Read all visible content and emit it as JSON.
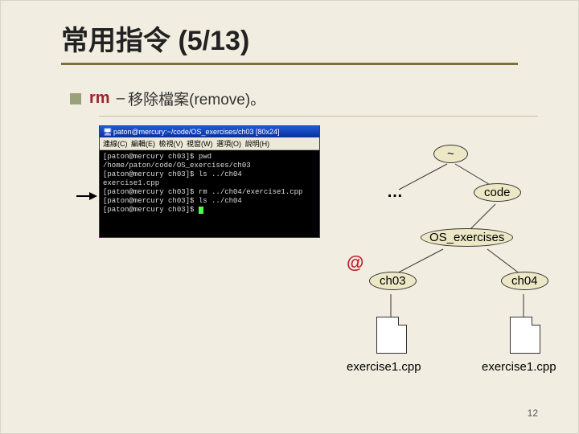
{
  "title": "常用指令 (5/13)",
  "bullet": {
    "cmd": "rm",
    "dash": "–",
    "desc": "移除檔案(remove)。"
  },
  "terminal": {
    "title": "paton@mercury:~/code/OS_exercises/ch03 [80x24]",
    "menu": [
      "連線(C)",
      "編輯(E)",
      "檢視(V)",
      "視窗(W)",
      "選項(O)",
      "說明(H)"
    ],
    "lines": [
      "[paton@mercury ch03]$ pwd",
      "/home/paton/code/OS_exercises/ch03",
      "[paton@mercury ch03]$ ls ../ch04",
      "exercise1.cpp",
      "[paton@mercury ch03]$ rm ../ch04/exercise1.cpp",
      "[paton@mercury ch03]$ ls ../ch04",
      "[paton@mercury ch03]$ "
    ]
  },
  "tree": {
    "root": "~",
    "dots": "…",
    "code": "code",
    "os_ex": "OS_exercises",
    "ch03": "ch03",
    "ch04": "ch04",
    "file1": "exercise1.cpp",
    "file2": "exercise1.cpp",
    "at": "@"
  },
  "slide_number": "12"
}
